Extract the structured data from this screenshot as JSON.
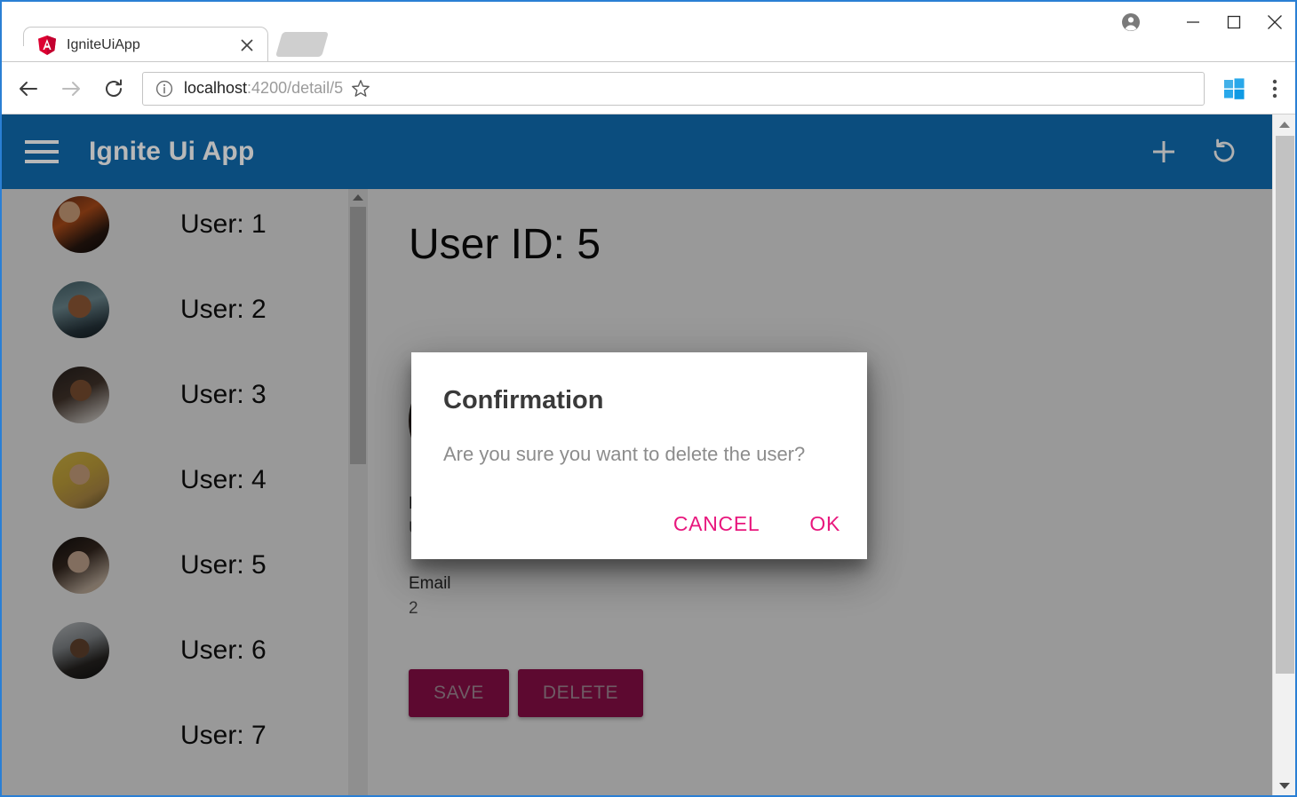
{
  "browser": {
    "tab": {
      "title": "IgniteUiApp",
      "favicon": "angular-icon",
      "close_icon": "close-icon"
    },
    "new_tab_icon": "new-tab-icon",
    "nav": {
      "back_icon": "back-arrow-icon",
      "forward_icon": "forward-arrow-icon",
      "reload_icon": "reload-icon"
    },
    "omnibox": {
      "info_icon": "info-circle-icon",
      "url_host": "localhost",
      "url_path": ":4200/detail/5",
      "bookmark_icon": "star-icon"
    },
    "extension_icon": "windows-extension-icon",
    "menu_icon": "three-dot-menu-icon",
    "window_controls": {
      "profile_icon": "profile-avatar-icon",
      "minimize_icon": "minimize-icon",
      "maximize_icon": "maximize-icon",
      "close_icon": "window-close-icon"
    }
  },
  "app": {
    "toolbar": {
      "menu_icon": "hamburger-menu-icon",
      "title": "Ignite Ui App",
      "add_icon": "plus-icon",
      "refresh_icon": "refresh-icon"
    },
    "sidebar": {
      "users": [
        {
          "label": "User: 1",
          "avatar": "avatar-user-1"
        },
        {
          "label": "User: 2",
          "avatar": "avatar-user-2"
        },
        {
          "label": "User: 3",
          "avatar": "avatar-user-3"
        },
        {
          "label": "User: 4",
          "avatar": "avatar-user-4"
        },
        {
          "label": "User: 5",
          "avatar": "avatar-user-5"
        },
        {
          "label": "User: 6",
          "avatar": "avatar-user-6"
        },
        {
          "label": "User: 7",
          "avatar": "avatar-user-7"
        }
      ]
    },
    "detail": {
      "title": "User ID: 5",
      "avatar": "avatar-user-5",
      "name_label": "Name",
      "name_value": "User 5",
      "email_label": "Email",
      "email_value": "2",
      "save_label": "SAVE",
      "delete_label": "DELETE"
    },
    "dialog": {
      "title": "Confirmation",
      "message": "Are you sure you want to delete the user?",
      "cancel_label": "CANCEL",
      "ok_label": "OK"
    }
  },
  "colors": {
    "toolbar_blue": "#0b4d7e",
    "accent_pink": "#e8177d",
    "button_magenta": "#9c1050",
    "tab_border": "#c8c8c8"
  }
}
